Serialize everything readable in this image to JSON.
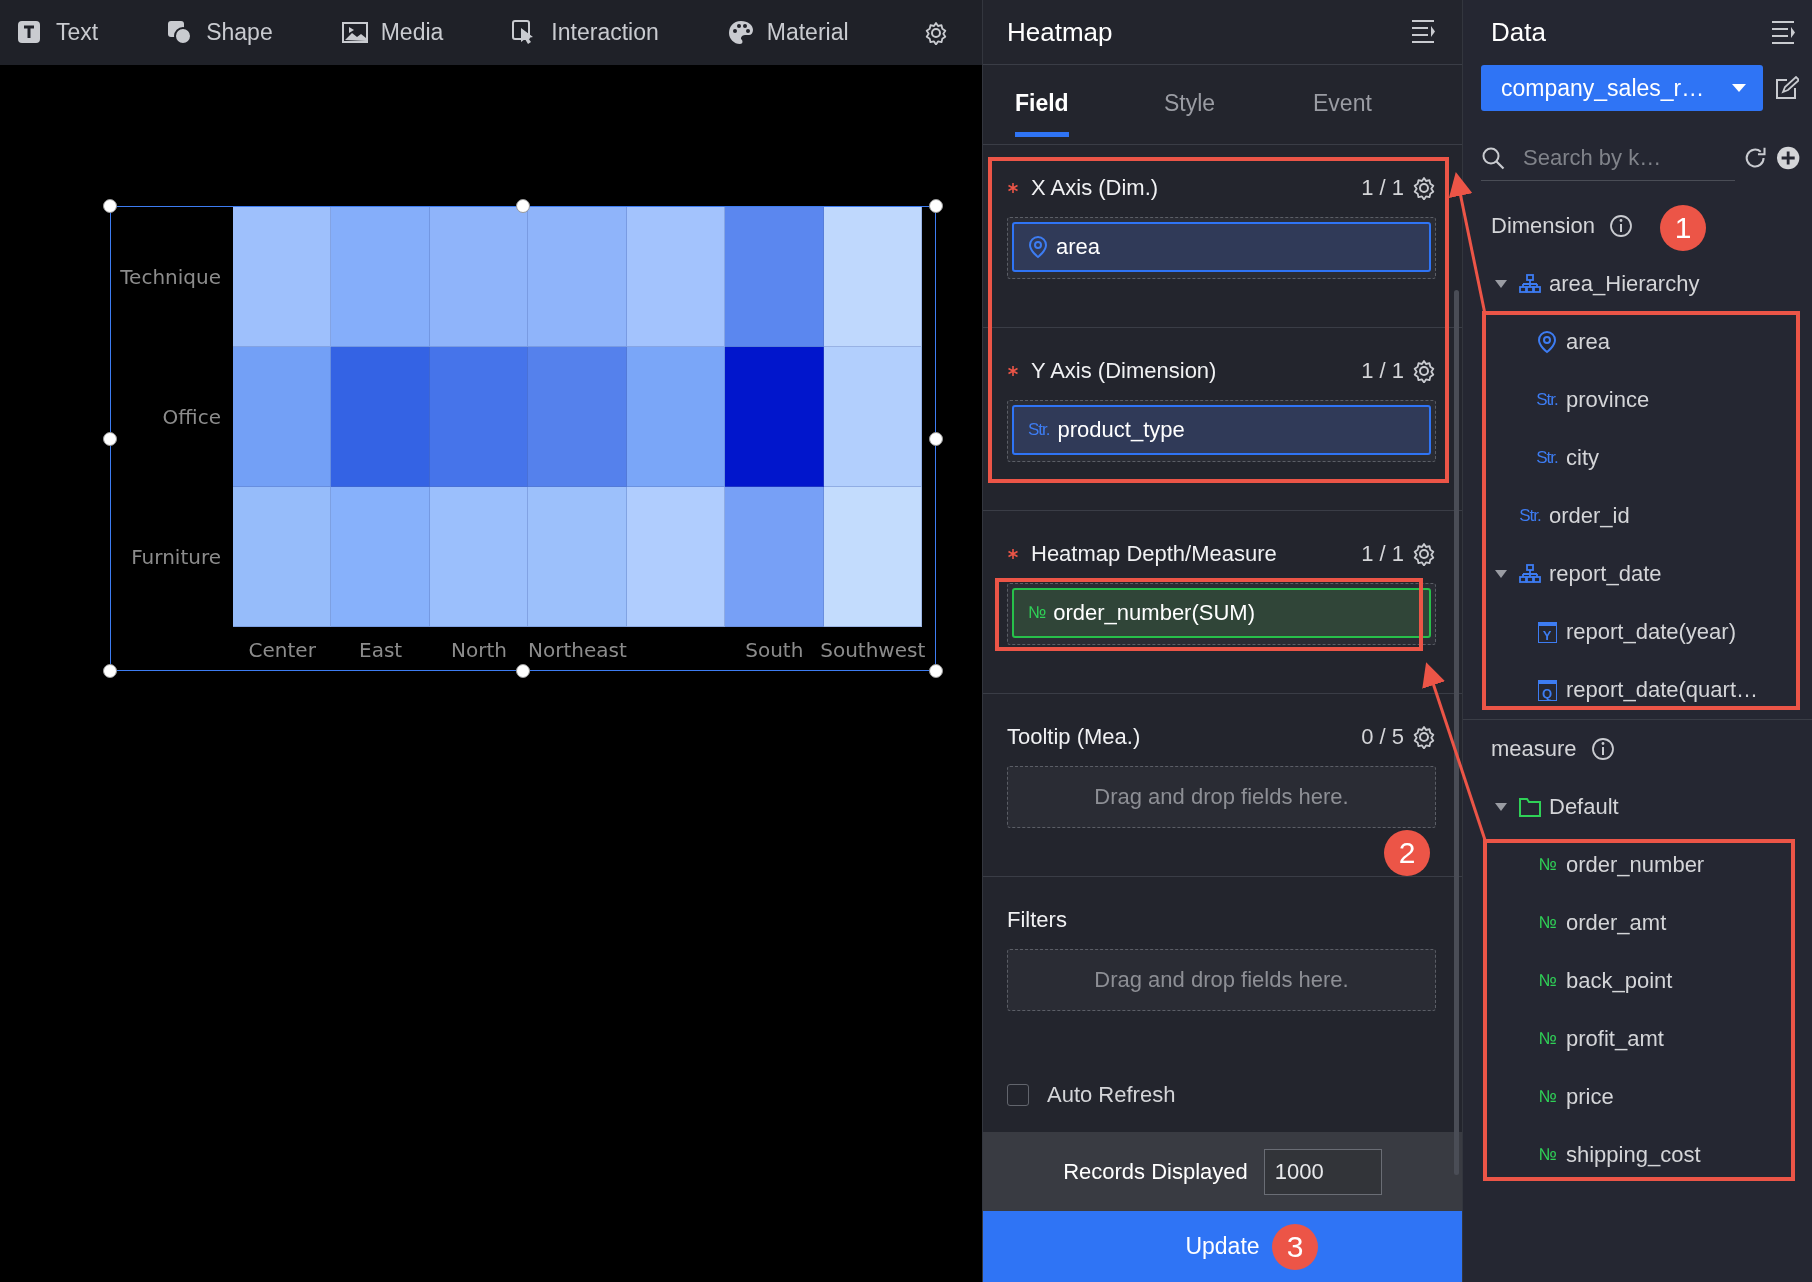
{
  "toolbar": {
    "items": [
      {
        "label": "Text",
        "kind": "text"
      },
      {
        "label": "Shape",
        "kind": "shape"
      },
      {
        "label": "Media",
        "kind": "media"
      },
      {
        "label": "Interaction",
        "kind": "interaction"
      },
      {
        "label": "Material",
        "kind": "material"
      }
    ]
  },
  "canvas": {
    "heatmap": {
      "selected": true,
      "columns": [
        "Center",
        "East",
        "North",
        "Northeast",
        null,
        "South",
        "Southwest"
      ],
      "rows": [
        {
          "label": "Technique",
          "cells": [
            {
              "color": "#9ec0fc"
            },
            {
              "color": "#85aefa"
            },
            {
              "color": "#8fb4fa"
            },
            {
              "color": "#8fb4fa"
            },
            {
              "color": "#a3c3fd"
            },
            {
              "color": "#5b87ef"
            },
            {
              "color": "#bfd8fd"
            }
          ]
        },
        {
          "label": "Office",
          "cells": [
            {
              "color": "#73a0f6"
            },
            {
              "color": "#3463e4"
            },
            {
              "color": "#4674ea"
            },
            {
              "color": "#5581ec"
            },
            {
              "color": "#7aa6f8"
            },
            {
              "color": "#0116cc"
            },
            {
              "color": "#b2cffd"
            }
          ]
        },
        {
          "label": "Furniture",
          "cells": [
            {
              "color": "#96bcfa"
            },
            {
              "color": "#87b1fb"
            },
            {
              "color": "#9bbffc"
            },
            {
              "color": "#9cc0fb"
            },
            {
              "color": "#b0cdfe"
            },
            {
              "color": "#77a0f6"
            },
            {
              "color": "#c3dcfd"
            }
          ]
        }
      ]
    }
  },
  "config_panel": {
    "title": "Heatmap",
    "tabs": [
      {
        "label": "Field",
        "selected": true
      },
      {
        "label": "Style",
        "selected": false
      },
      {
        "label": "Event",
        "selected": false
      }
    ],
    "sections": [
      {
        "title": "X Axis (Dim.)",
        "required": true,
        "count": "1 / 1",
        "fields": [
          {
            "name": "area",
            "kind": "geo"
          }
        ]
      },
      {
        "title": "Y Axis (Dimension)",
        "required": true,
        "count": "1 / 1",
        "fields": [
          {
            "name": "product_type",
            "kind": "str",
            "tag": "Str."
          }
        ]
      },
      {
        "title": "Heatmap Depth/Measure",
        "required": true,
        "count": "1 / 1",
        "fields": [
          {
            "name": "order_number(SUM)",
            "kind": "num",
            "tag": "№"
          }
        ]
      },
      {
        "title": "Tooltip (Mea.)",
        "required": false,
        "count": "0 / 5",
        "placeholder": "Drag and drop fields here."
      },
      {
        "title": "Filters",
        "required": false,
        "placeholder": "Drag and drop fields here."
      }
    ],
    "auto_refresh": {
      "label": "Auto Refresh",
      "checked": false
    },
    "records": {
      "label": "Records Displayed",
      "value": "1000"
    },
    "update_button": "Update"
  },
  "data_panel": {
    "title": "Data",
    "dataset": "company_sales_r…",
    "search": {
      "placeholder": "Search by k…"
    },
    "dimension": {
      "title": "Dimension",
      "items": [
        {
          "label": "area_Hierarchy",
          "kind": "hierarchy",
          "expanded": true,
          "children": [
            {
              "label": "area",
              "kind": "geo"
            },
            {
              "label": "province",
              "kind": "str",
              "tag": "Str."
            },
            {
              "label": "city",
              "kind": "str",
              "tag": "Str."
            }
          ]
        },
        {
          "label": "order_id",
          "kind": "str",
          "tag": "Str."
        },
        {
          "label": "report_date",
          "kind": "hierarchy",
          "expanded": true,
          "children": [
            {
              "label": "report_date(year)",
              "kind": "date",
              "tag": "Y"
            },
            {
              "label": "report_date(quart…",
              "kind": "date",
              "tag": "Q"
            }
          ]
        }
      ]
    },
    "measure": {
      "title": "measure",
      "items": [
        {
          "label": "Default",
          "kind": "folder",
          "expanded": true,
          "children": [
            {
              "label": "order_number",
              "kind": "num",
              "tag": "№"
            },
            {
              "label": "order_amt",
              "kind": "num",
              "tag": "№"
            },
            {
              "label": "back_point",
              "kind": "num",
              "tag": "№"
            },
            {
              "label": "profit_amt",
              "kind": "num",
              "tag": "№"
            },
            {
              "label": "price",
              "kind": "num",
              "tag": "№"
            },
            {
              "label": "shipping_cost",
              "kind": "num",
              "tag": "№"
            }
          ]
        }
      ]
    }
  },
  "annotations": {
    "badges": [
      "1",
      "2",
      "3"
    ]
  }
}
